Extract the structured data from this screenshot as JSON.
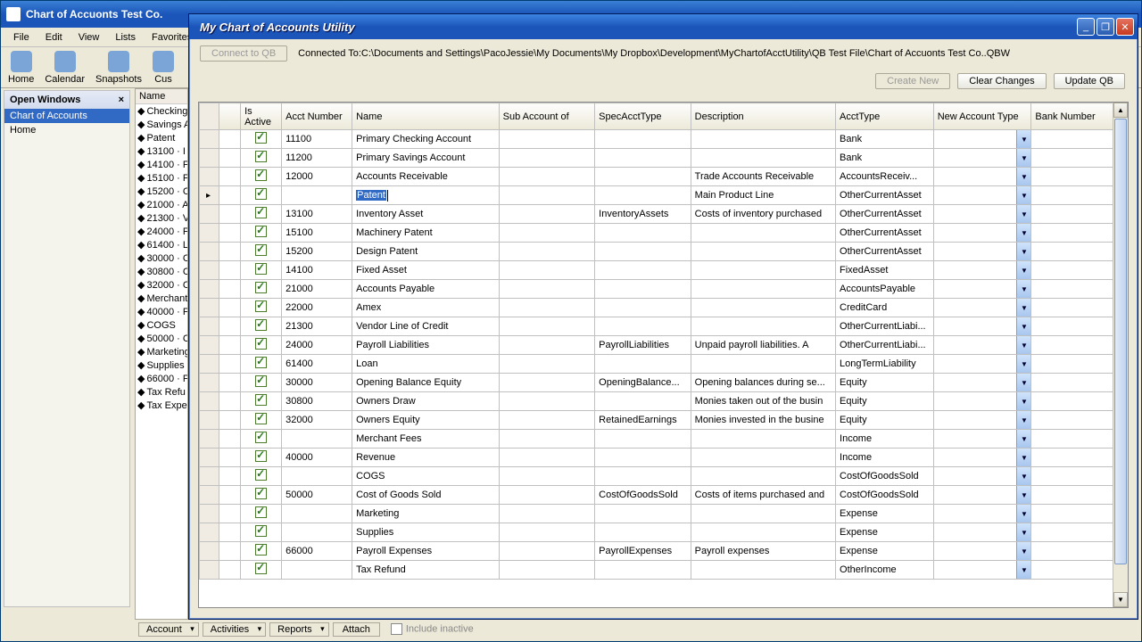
{
  "host": {
    "title": "Chart of Accuonts Test Co.",
    "menu": [
      "File",
      "Edit",
      "View",
      "Lists",
      "Favorites"
    ],
    "toolbar": [
      "Home",
      "Calendar",
      "Snapshots",
      "Cus"
    ]
  },
  "sidebar": {
    "title": "Open Windows",
    "items": [
      "Chart of Accounts",
      "Home"
    ],
    "selected": 0
  },
  "navlist": {
    "header": "Name",
    "rows": [
      "Checking",
      "Savings A",
      "Patent",
      "13100 · I",
      "14100 · F",
      "15100 · F",
      "15200 · C",
      "21000 · A",
      "21300 · V",
      "24000 · F",
      "61400 · L",
      "30000 · C",
      "30800 · C",
      "32000 · C",
      "Merchant",
      "40000 · F",
      "COGS",
      "50000 · C",
      "Marketing",
      "Supplies",
      "66000 · F",
      "Tax Refu",
      "Tax Expe"
    ]
  },
  "bottombar": {
    "account": "Account",
    "activities": "Activities",
    "reports": "Reports",
    "attach": "Attach",
    "include": "Include inactive"
  },
  "child": {
    "title": "My Chart of Accounts Utility",
    "connect_btn": "Connect to QB",
    "connected": "Connected To:C:\\Documents and Settings\\PacoJessie\\My Documents\\My Dropbox\\Development\\MyChartofAcctUtility\\QB Test File\\Chart of Accuonts Test Co..QBW",
    "create_btn": "Create New",
    "clear_btn": "Clear Changes",
    "update_btn": "Update QB",
    "columns": [
      "",
      "Is Active",
      "Acct Number",
      "Name",
      "Sub Account of",
      "SpecAcctType",
      "Description",
      "AcctType",
      "New Account Type",
      "Bank Number"
    ],
    "rows": [
      {
        "active": true,
        "num": "11100",
        "name": "Primary Checking Account",
        "sub": "",
        "spec": "",
        "desc": "",
        "type": "Bank",
        "new": "",
        "bank": ""
      },
      {
        "active": true,
        "num": "11200",
        "name": "Primary Savings Account",
        "sub": "",
        "spec": "",
        "desc": "",
        "type": "Bank",
        "new": "",
        "bank": ""
      },
      {
        "active": true,
        "num": "12000",
        "name": "Accounts Receivable",
        "sub": "",
        "spec": "",
        "desc": "Trade Accounts Receivable",
        "type": "AccountsReceiv...",
        "new": "",
        "bank": ""
      },
      {
        "active": true,
        "num": "",
        "name": "Patent",
        "sub": "",
        "spec": "",
        "desc": "Main Product Line",
        "type": "OtherCurrentAsset",
        "new": "",
        "bank": "",
        "editing": true,
        "selected": true
      },
      {
        "active": true,
        "num": "13100",
        "name": "Inventory Asset",
        "sub": "",
        "spec": "InventoryAssets",
        "desc": "Costs of inventory purchased",
        "type": "OtherCurrentAsset",
        "new": "",
        "bank": ""
      },
      {
        "active": true,
        "num": "15100",
        "name": "Machinery Patent",
        "sub": "",
        "spec": "",
        "desc": "",
        "type": "OtherCurrentAsset",
        "new": "",
        "bank": ""
      },
      {
        "active": true,
        "num": "15200",
        "name": "Design Patent",
        "sub": "",
        "spec": "",
        "desc": "",
        "type": "OtherCurrentAsset",
        "new": "",
        "bank": ""
      },
      {
        "active": true,
        "num": "14100",
        "name": "Fixed Asset",
        "sub": "",
        "spec": "",
        "desc": "",
        "type": "FixedAsset",
        "new": "",
        "bank": ""
      },
      {
        "active": true,
        "num": "21000",
        "name": "Accounts Payable",
        "sub": "",
        "spec": "",
        "desc": "",
        "type": "AccountsPayable",
        "new": "",
        "bank": ""
      },
      {
        "active": true,
        "num": "22000",
        "name": "Amex",
        "sub": "",
        "spec": "",
        "desc": "",
        "type": "CreditCard",
        "new": "",
        "bank": ""
      },
      {
        "active": true,
        "num": "21300",
        "name": "Vendor Line of Credit",
        "sub": "",
        "spec": "",
        "desc": "",
        "type": "OtherCurrentLiabi...",
        "new": "",
        "bank": ""
      },
      {
        "active": true,
        "num": "24000",
        "name": "Payroll Liabilities",
        "sub": "",
        "spec": "PayrollLiabilities",
        "desc": "Unpaid payroll liabilities. A",
        "type": "OtherCurrentLiabi...",
        "new": "",
        "bank": ""
      },
      {
        "active": true,
        "num": "61400",
        "name": "Loan",
        "sub": "",
        "spec": "",
        "desc": "",
        "type": "LongTermLiability",
        "new": "",
        "bank": ""
      },
      {
        "active": true,
        "num": "30000",
        "name": "Opening Balance Equity",
        "sub": "",
        "spec": "OpeningBalance...",
        "desc": "Opening balances during se...",
        "type": "Equity",
        "new": "",
        "bank": ""
      },
      {
        "active": true,
        "num": "30800",
        "name": "Owners Draw",
        "sub": "",
        "spec": "",
        "desc": "Monies taken out of the busin",
        "type": "Equity",
        "new": "",
        "bank": ""
      },
      {
        "active": true,
        "num": "32000",
        "name": "Owners Equity",
        "sub": "",
        "spec": "RetainedEarnings",
        "desc": "Monies invested in the busine",
        "type": "Equity",
        "new": "",
        "bank": ""
      },
      {
        "active": true,
        "num": "",
        "name": "Merchant Fees",
        "sub": "",
        "spec": "",
        "desc": "",
        "type": "Income",
        "new": "",
        "bank": ""
      },
      {
        "active": true,
        "num": "40000",
        "name": "Revenue",
        "sub": "",
        "spec": "",
        "desc": "",
        "type": "Income",
        "new": "",
        "bank": ""
      },
      {
        "active": true,
        "num": "",
        "name": "COGS",
        "sub": "",
        "spec": "",
        "desc": "",
        "type": "CostOfGoodsSold",
        "new": "",
        "bank": ""
      },
      {
        "active": true,
        "num": "50000",
        "name": "Cost of Goods Sold",
        "sub": "",
        "spec": "CostOfGoodsSold",
        "desc": "Costs of items purchased and",
        "type": "CostOfGoodsSold",
        "new": "",
        "bank": ""
      },
      {
        "active": true,
        "num": "",
        "name": "Marketing",
        "sub": "",
        "spec": "",
        "desc": "",
        "type": "Expense",
        "new": "",
        "bank": ""
      },
      {
        "active": true,
        "num": "",
        "name": "Supplies",
        "sub": "",
        "spec": "",
        "desc": "",
        "type": "Expense",
        "new": "",
        "bank": ""
      },
      {
        "active": true,
        "num": "66000",
        "name": "Payroll Expenses",
        "sub": "",
        "spec": "PayrollExpenses",
        "desc": "Payroll expenses",
        "type": "Expense",
        "new": "",
        "bank": ""
      },
      {
        "active": true,
        "num": "",
        "name": "Tax Refund",
        "sub": "",
        "spec": "",
        "desc": "",
        "type": "OtherIncome",
        "new": "",
        "bank": ""
      }
    ]
  }
}
